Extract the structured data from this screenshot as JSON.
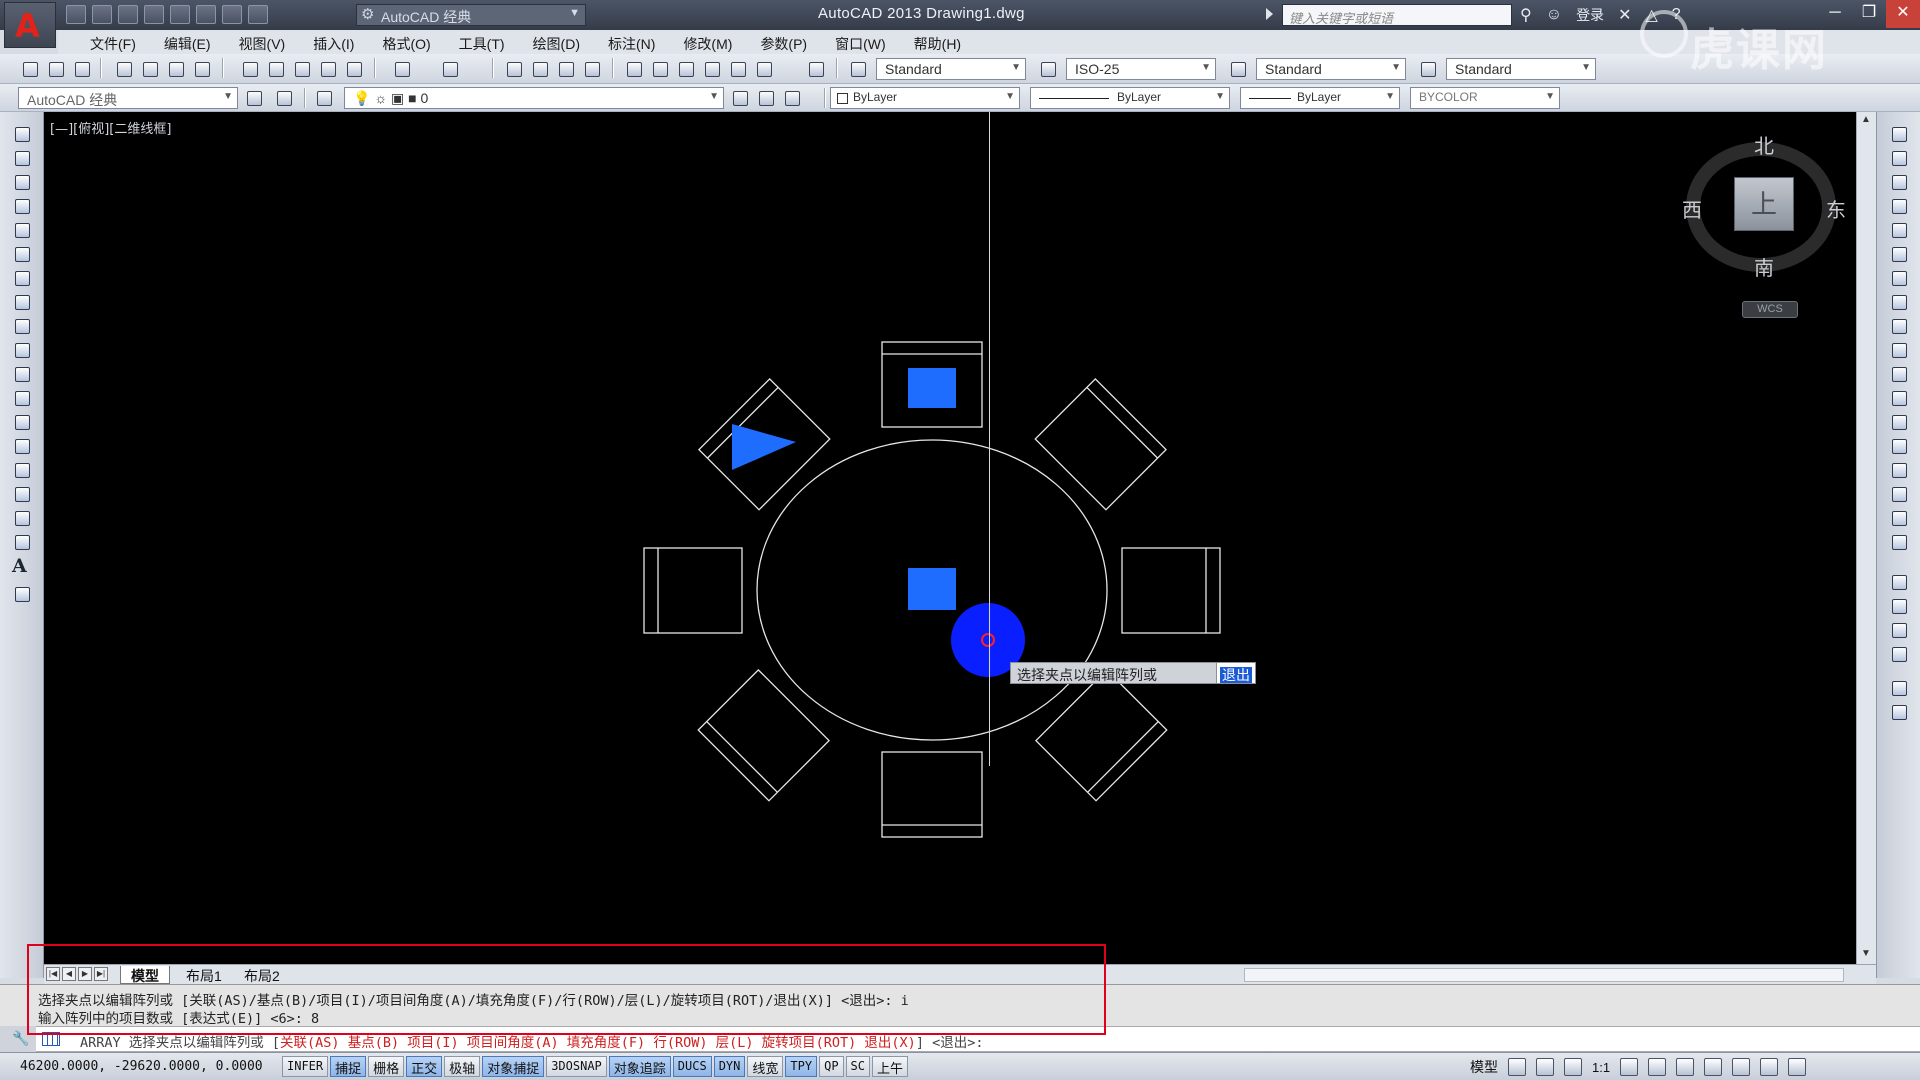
{
  "titlebar": {
    "workspace": "AutoCAD 经典",
    "title": "AutoCAD 2013    Drawing1.dwg",
    "search_placeholder": "键入关键字或短语",
    "login": "登录"
  },
  "menu": [
    "文件(F)",
    "编辑(E)",
    "视图(V)",
    "插入(I)",
    "格式(O)",
    "工具(T)",
    "绘图(D)",
    "标注(N)",
    "修改(M)",
    "参数(P)",
    "窗口(W)",
    "帮助(H)"
  ],
  "styles": {
    "text_style": "Standard",
    "dim_style": "ISO-25",
    "table_style": "Standard",
    "multileader_style": "Standard"
  },
  "properties": {
    "workspace2": "AutoCAD 经典",
    "layer": "0",
    "color": "ByLayer",
    "linetype": "ByLayer",
    "lineweight": "ByLayer",
    "plotstyle": "BYCOLOR"
  },
  "viewport": {
    "label": "[—][俯视][二维线框]"
  },
  "viewcube": {
    "north": "北",
    "south": "南",
    "west": "西",
    "east": "东",
    "face": "上",
    "wcs": "WCS"
  },
  "tooltip": {
    "prompt": "选择夹点以编辑阵列或",
    "option": "退出"
  },
  "layout_tabs": [
    "模型",
    "布局1",
    "布局2"
  ],
  "command": {
    "history_line1": "选择夹点以编辑阵列或 [关联(AS)/基点(B)/项目(I)/项目间角度(A)/填充角度(F)/行(ROW)/层(L)/旋转项目(ROT)/退出(X)] <退出>: i",
    "history_line2": "输入阵列中的项目数或 [表达式(E)] <6>: 8",
    "current_cmd": "ARRAY",
    "current_prompt": "选择夹点以编辑阵列或",
    "current_options": [
      "关联(AS)",
      "基点(B)",
      "项目(I)",
      "项目间角度(A)",
      "填充角度(F)",
      "行(ROW)",
      "层(L)",
      "旋转项目(ROT)",
      "退出(X)"
    ],
    "current_default": "<退出>:"
  },
  "status": {
    "coords": "46200.0000, -29620.0000, 0.0000",
    "buttons": [
      "INFER",
      "捕捉",
      "栅格",
      "正交",
      "极轴",
      "对象捕捉",
      "3DOSNAP",
      "对象追踪",
      "DUCS",
      "DYN",
      "线宽",
      "TPY",
      "QP",
      "SC",
      "上午"
    ],
    "model": "模型",
    "scale": "1:1"
  },
  "watermark": "虎课网",
  "colors": {
    "accent_blue": "#1e6dff",
    "grip_blue": "#0a1fff",
    "highlight_red": "#e0001b"
  }
}
